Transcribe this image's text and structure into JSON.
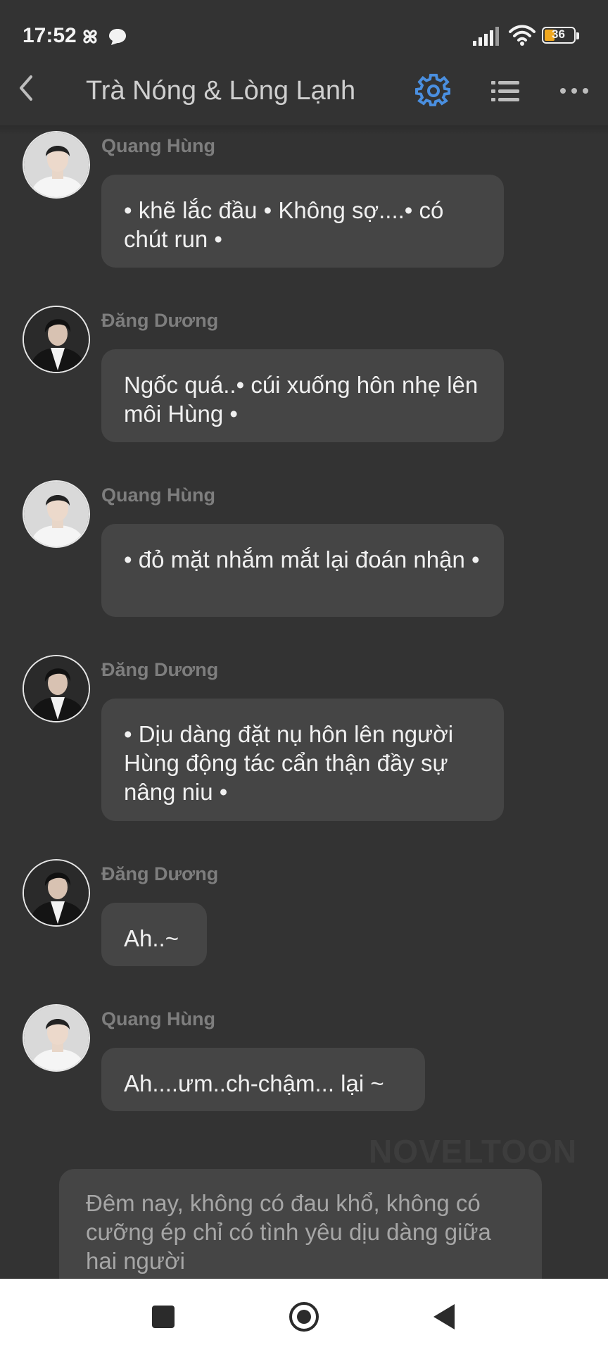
{
  "status_bar": {
    "time": "17:52",
    "icons": [
      "pinwheel-icon",
      "chat-bubble-icon",
      "signal-icon",
      "wifi-icon",
      "battery-icon"
    ],
    "battery_level": "36",
    "battery_color": "#f0a820"
  },
  "header": {
    "title": "Trà Nóng & Lòng Lạnh",
    "accent_color": "#4a8fe0",
    "icons": [
      "back-icon",
      "settings-gear-icon",
      "list-icon",
      "more-icon"
    ]
  },
  "messages": [
    {
      "sender": "Quang Hùng",
      "text": "• khẽ lắc đầu • Không sợ....• có chút run •"
    },
    {
      "sender": "Đăng Dương",
      "text": "Ngốc quá..• cúi xuống hôn nhẹ lên môi Hùng •"
    },
    {
      "sender": "Quang Hùng",
      "text": "• đỏ mặt nhắm mắt lại đoán nhận •"
    },
    {
      "sender": "Đăng Dương",
      "text": "• Dịu dàng đặt nụ hôn lên người Hùng  động tác cẩn thận đầy sự nâng niu •"
    },
    {
      "sender": "Đăng Dương",
      "text": "Ah..~"
    },
    {
      "sender": "Quang Hùng",
      "text": "Ah....ưm..ch-chậm... lại ~"
    }
  ],
  "watermark": "NOVELTOON",
  "narration": "Đêm nay, không có đau khổ, không có cưỡng ép chỉ có tình yêu dịu dàng giữa hai người",
  "nav_bar": {
    "icons": [
      "recent-apps-square-icon",
      "home-circle-icon",
      "back-triangle-icon"
    ]
  }
}
